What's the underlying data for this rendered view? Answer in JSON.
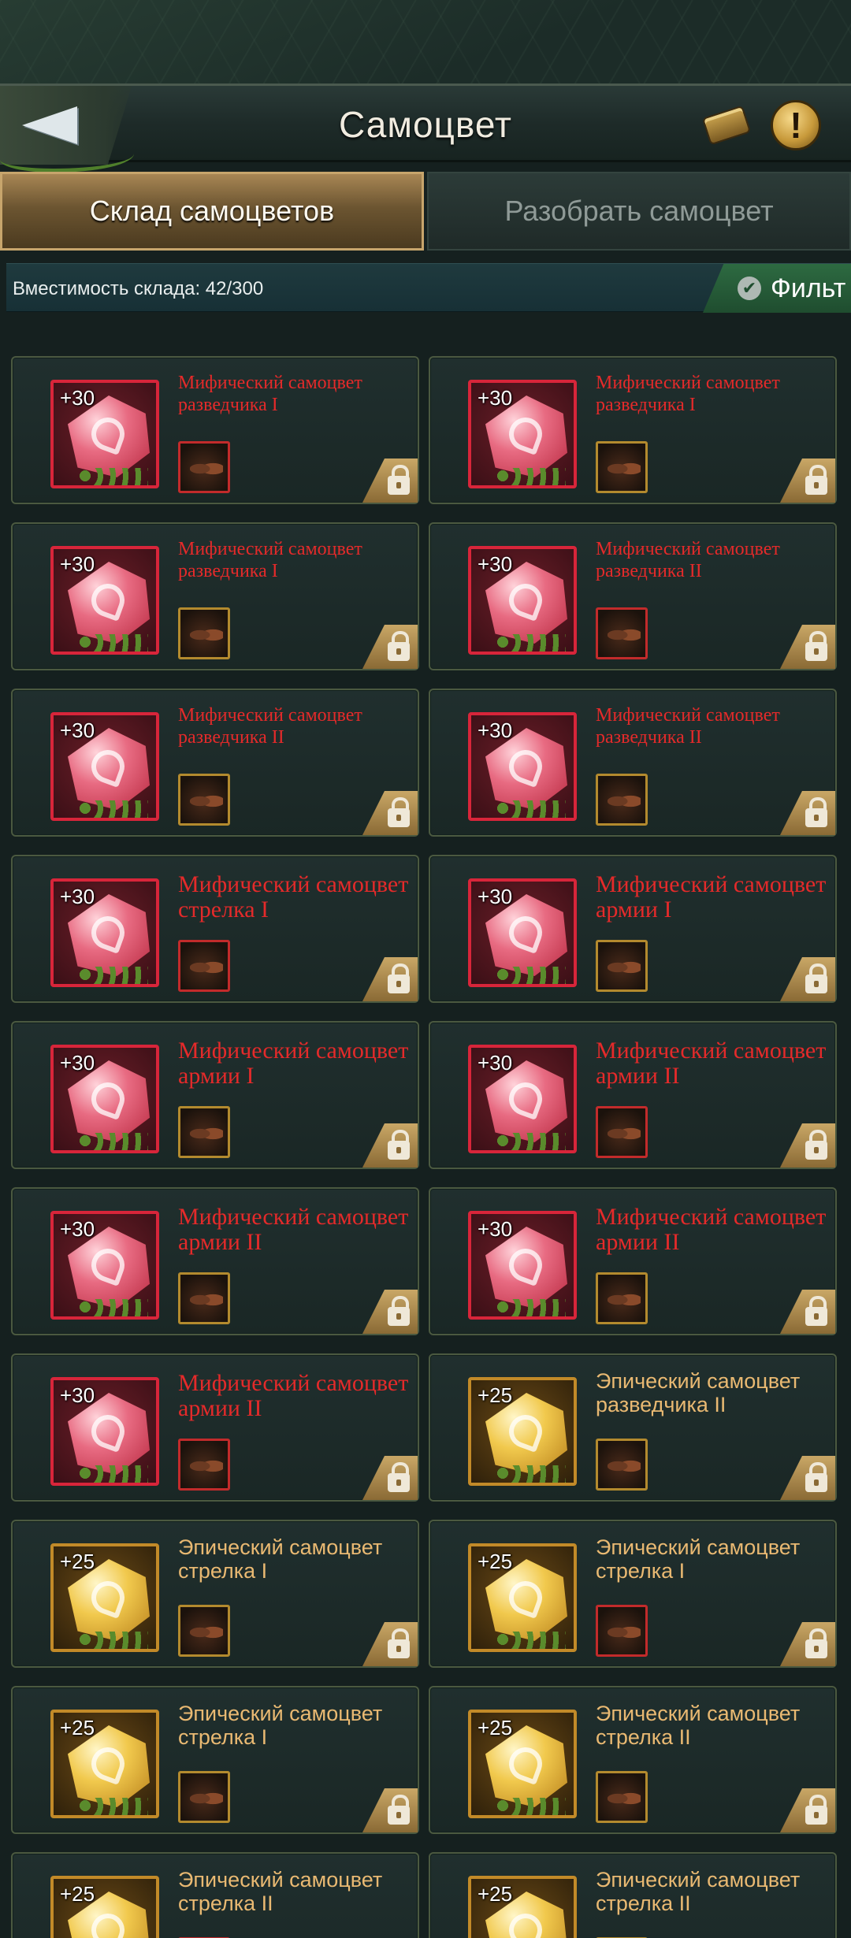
{
  "header": {
    "title": "Самоцвет",
    "back_icon": "back-arrow-icon",
    "chest_icon": "gem-chest-icon",
    "info_icon": "info-icon",
    "info_symbol": "!"
  },
  "tabs": [
    {
      "label": "Склад самоцветов",
      "active": true
    },
    {
      "label": "Разобрать самоцвет",
      "active": false
    }
  ],
  "capacity": {
    "text": "Вместимость склада: 42/300"
  },
  "filter": {
    "label": "Фильт",
    "check": "✔"
  },
  "colors": {
    "mythic_name": "#e42a2a",
    "epic_name": "#e9b972",
    "mythic_frame": "#d8253a",
    "epic_frame": "#c28a28"
  },
  "gems": [
    {
      "level": "+30",
      "name": "Мифический самоцвет разведчика I",
      "rarity": "mythic"
    },
    {
      "level": "+30",
      "name": "Мифический самоцвет разведчика I",
      "rarity": "mythic"
    },
    {
      "level": "+30",
      "name": "Мифический самоцвет разведчика I",
      "rarity": "mythic"
    },
    {
      "level": "+30",
      "name": "Мифический самоцвет разведчика II",
      "rarity": "mythic"
    },
    {
      "level": "+30",
      "name": "Мифический самоцвет разведчика II",
      "rarity": "mythic"
    },
    {
      "level": "+30",
      "name": "Мифический самоцвет разведчика II",
      "rarity": "mythic"
    },
    {
      "level": "+30",
      "name": "Мифический самоцвет стрелка I",
      "rarity": "mythic"
    },
    {
      "level": "+30",
      "name": "Мифический самоцвет армии I",
      "rarity": "mythic"
    },
    {
      "level": "+30",
      "name": "Мифический самоцвет армии I",
      "rarity": "mythic"
    },
    {
      "level": "+30",
      "name": "Мифический самоцвет армии II",
      "rarity": "mythic"
    },
    {
      "level": "+30",
      "name": "Мифический самоцвет армии II",
      "rarity": "mythic"
    },
    {
      "level": "+30",
      "name": "Мифический самоцвет армии II",
      "rarity": "mythic"
    },
    {
      "level": "+30",
      "name": "Мифический самоцвет армии II",
      "rarity": "mythic"
    },
    {
      "level": "+25",
      "name": "Эпический самоцвет разведчика II",
      "rarity": "epic"
    },
    {
      "level": "+25",
      "name": "Эпический самоцвет стрелка I",
      "rarity": "epic"
    },
    {
      "level": "+25",
      "name": "Эпический самоцвет стрелка I",
      "rarity": "epic"
    },
    {
      "level": "+25",
      "name": "Эпический самоцвет стрелка I",
      "rarity": "epic"
    },
    {
      "level": "+25",
      "name": "Эпический самоцвет стрелка II",
      "rarity": "epic"
    },
    {
      "level": "+25",
      "name": "Эпический самоцвет стрелка II",
      "rarity": "epic"
    },
    {
      "level": "+25",
      "name": "Эпический самоцвет стрелка II",
      "rarity": "epic"
    }
  ]
}
